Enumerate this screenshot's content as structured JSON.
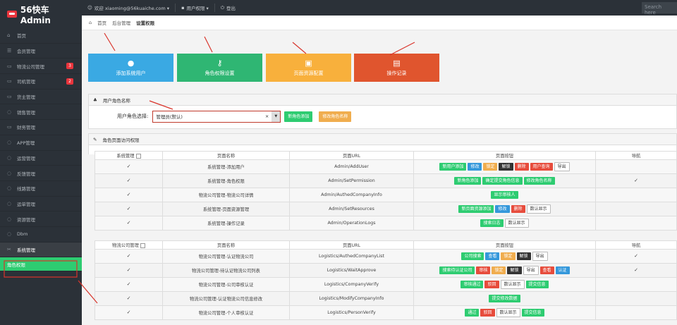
{
  "brand": "56快车 Admin",
  "topbar": {
    "user": "欢迎 xiaoming@56kuaiche.com ▾",
    "role": "用户权限 ▾",
    "logout": "登出",
    "search": "Search here"
  },
  "sidebar": [
    {
      "label": "首页",
      "icon": "home-icon",
      "glyph": "⌂"
    },
    {
      "label": "会员管理",
      "icon": "users-icon",
      "glyph": "☰"
    },
    {
      "label": "物流公司管理",
      "icon": "truck-icon",
      "glyph": "▭",
      "badge": "3"
    },
    {
      "label": "司机管理",
      "icon": "driver-icon",
      "glyph": "▭",
      "badge": "2"
    },
    {
      "label": "货主管理",
      "icon": "owner-icon",
      "glyph": "▭"
    },
    {
      "label": "销售管理",
      "icon": "sales-icon",
      "glyph": "◌"
    },
    {
      "label": "财务管理",
      "icon": "finance-icon",
      "glyph": "▭"
    },
    {
      "label": "APP管理",
      "icon": "app-icon",
      "glyph": "◌"
    },
    {
      "label": "运营管理",
      "icon": "ops-icon",
      "glyph": "◌"
    },
    {
      "label": "反馈管理",
      "icon": "feedback-icon",
      "glyph": "◌"
    },
    {
      "label": "线路管理",
      "icon": "route-icon",
      "glyph": "◌"
    },
    {
      "label": "运单管理",
      "icon": "waybill-icon",
      "glyph": "◌"
    },
    {
      "label": "资源管理",
      "icon": "resource-icon",
      "glyph": "◌"
    },
    {
      "label": "Dbm",
      "icon": "db-icon",
      "glyph": "◌"
    },
    {
      "label": "系统管理",
      "icon": "settings-icon",
      "glyph": "✂"
    }
  ],
  "sidebar_sub": "角色权限",
  "crumbs": [
    "首页",
    "后台管理",
    "设置权限"
  ],
  "tiles": [
    {
      "label": "添加系统用户",
      "color": "#3aa9e3",
      "icon": "user-icon",
      "glyph": "●"
    },
    {
      "label": "角色权限设置",
      "color": "#2fb673",
      "icon": "key-icon",
      "glyph": "⚷"
    },
    {
      "label": "页面资源配置",
      "color": "#f8b03c",
      "icon": "inbox-icon",
      "glyph": "▣"
    },
    {
      "label": "操作记录",
      "color": "#e0552e",
      "icon": "book-icon",
      "glyph": "▤"
    }
  ],
  "role_panel": {
    "title": "用户角色名称",
    "label": "用户角色选择:",
    "value": "管理员(默认)",
    "add": "新角色添加",
    "rename": "修改角色名称"
  },
  "access_panel": {
    "title": "角色页面访问权限"
  },
  "headers": [
    "页面名称",
    "页面URL",
    "页面按钮",
    "导航"
  ],
  "groups": [
    {
      "name": "系统管理",
      "rows": [
        {
          "page": "系统管理-添加用户",
          "url": "Admin/AddUser",
          "nav": false,
          "btns": [
            [
              "新用户添加",
              "green"
            ],
            [
              "修改",
              "blue"
            ],
            [
              "锁定",
              "orange"
            ],
            [
              "解锁",
              "dark"
            ],
            [
              "删除",
              "red"
            ],
            [
              "用户查询",
              "red"
            ],
            [
              "导出",
              "white"
            ]
          ]
        },
        {
          "page": "系统管理-角色权限",
          "url": "Admin/SetPermission",
          "nav": true,
          "btns": [
            [
              "新角色添加",
              "green"
            ],
            [
              "确定提交角色信息",
              "green"
            ],
            [
              "修改角色名称",
              "green"
            ]
          ]
        },
        {
          "page": "物流公司管理-物流公司详情",
          "url": "Admin/AuthedCompanyInfo",
          "nav": false,
          "btns": [
            [
              "显示审核人",
              "green"
            ]
          ]
        },
        {
          "page": "系统管理-页面资源管理",
          "url": "Admin/SetResources",
          "nav": false,
          "btns": [
            [
              "新页面资源添加",
              "green"
            ],
            [
              "修改",
              "blue"
            ],
            [
              "删除",
              "red"
            ],
            [
              "数认显示",
              "white"
            ]
          ]
        },
        {
          "page": "系统管理-操作记录",
          "url": "Admin/OperationLogs",
          "nav": false,
          "btns": [
            [
              "搜索日志",
              "green"
            ],
            [
              "数认显示",
              "white"
            ]
          ]
        }
      ]
    },
    {
      "name": "物流公司管理",
      "rows": [
        {
          "page": "物流公司管理-认证物流公司",
          "url": "Logistics/AuthedCompanyList",
          "nav": true,
          "btns": [
            [
              "公司搜索",
              "green"
            ],
            [
              "查看",
              "blue"
            ],
            [
              "锁定",
              "orange"
            ],
            [
              "解锁",
              "dark"
            ],
            [
              "导出",
              "white"
            ]
          ]
        },
        {
          "page": "物流公司管理-待认证物流公司列表",
          "url": "Logistics/WaitApprove",
          "nav": true,
          "btns": [
            [
              "搜索待认证公司",
              "green"
            ],
            [
              "审核",
              "red"
            ],
            [
              "锁定",
              "orange"
            ],
            [
              "解锁",
              "dark"
            ],
            [
              "导出",
              "white"
            ],
            [
              "查看",
              "red"
            ],
            [
              "认证",
              "blue"
            ]
          ]
        },
        {
          "page": "物流公司管理-公司审核认证",
          "url": "Logistics/CompanyVerify",
          "nav": false,
          "btns": [
            [
              "审核通过",
              "green"
            ],
            [
              "驳回",
              "red"
            ],
            [
              "数认显示",
              "white"
            ],
            [
              "提交信息",
              "green"
            ]
          ]
        },
        {
          "page": "物流公司管理-认证物流公司信息修改",
          "url": "Logistics/ModifyCompanyInfo",
          "nav": false,
          "btns": [
            [
              "提交修改数据",
              "green"
            ]
          ]
        },
        {
          "page": "物流公司管理-个人审核认证",
          "url": "Logistics/PersonVerify",
          "nav": false,
          "btns": [
            [
              "通过",
              "green"
            ],
            [
              "驳回",
              "red"
            ],
            [
              "数认显示",
              "white"
            ],
            [
              "提交信息",
              "green"
            ]
          ]
        }
      ]
    }
  ]
}
